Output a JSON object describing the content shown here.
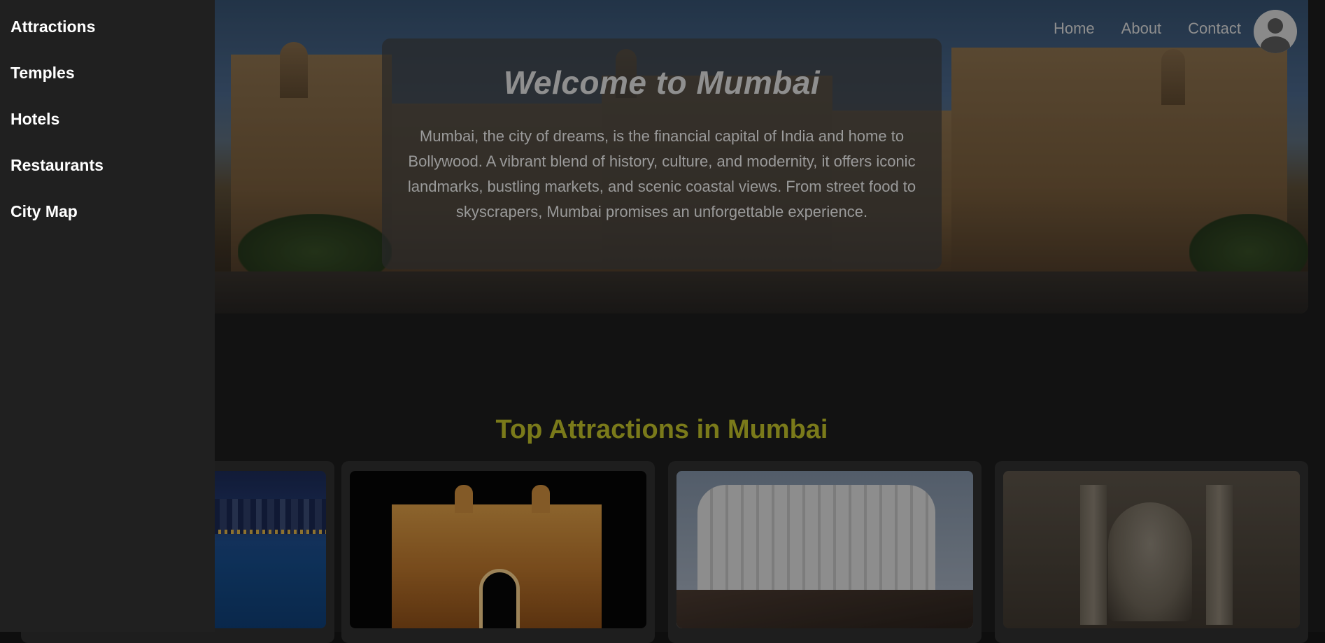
{
  "sidebar": {
    "items": [
      {
        "label": "Attractions"
      },
      {
        "label": "Temples"
      },
      {
        "label": "Hotels"
      },
      {
        "label": "Restaurants"
      },
      {
        "label": "City Map"
      }
    ]
  },
  "nav": {
    "home": "Home",
    "about": "About",
    "contact": "Contact",
    "profile_icon": "user-circle-icon"
  },
  "hero": {
    "title": "Welcome to Mumbai",
    "description": "Mumbai, the city of dreams, is the financial capital of India and home to Bollywood. A vibrant blend of history, culture, and modernity, it offers iconic landmarks, bustling markets, and scenic coastal views. From street food to skyscrapers, Mumbai promises an unforgettable experience."
  },
  "attractions": {
    "title": "Top Attractions in Mumbai"
  },
  "colors": {
    "sidebar_bg": "#202020",
    "page_bg": "#121212",
    "accent": "#7a7a1a"
  }
}
